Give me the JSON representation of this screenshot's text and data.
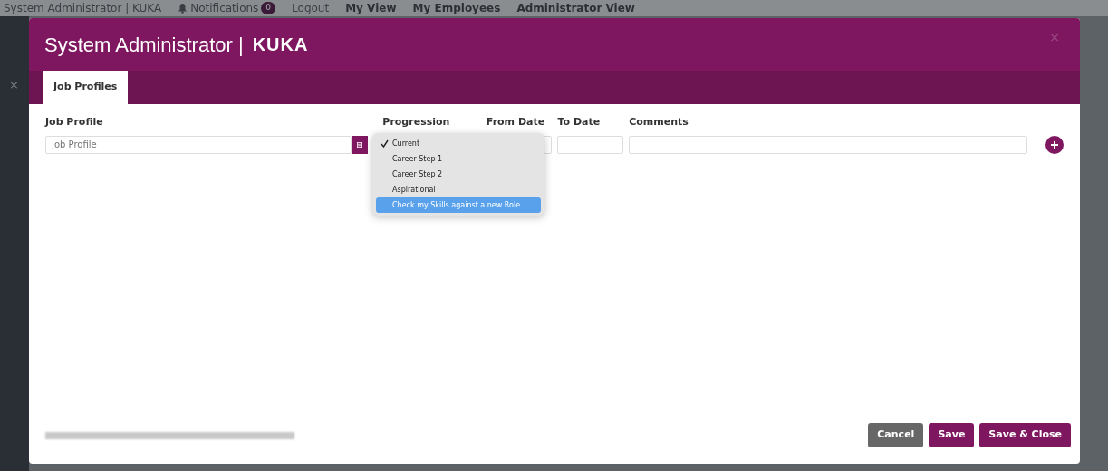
{
  "background_bar": {
    "title": "System Administrator | KUKA",
    "notifications": {
      "label": "Notifications",
      "count": "0"
    },
    "logout": "Logout",
    "close": "×",
    "nav": [
      {
        "label": "My View"
      },
      {
        "label": "My Employees"
      },
      {
        "label": "Administrator View"
      }
    ]
  },
  "modal": {
    "title": "System Administrator |",
    "logo": "KUKA",
    "close": "×",
    "tabs": [
      {
        "label": "Job Profiles",
        "selected": true
      }
    ],
    "fields": [
      {
        "kind": "lookup",
        "label": "Job Profile",
        "placeholder": "Job Profile"
      },
      {
        "kind": "select",
        "label": "Progression"
      },
      {
        "kind": "input",
        "label": "From Date"
      },
      {
        "kind": "input",
        "label": "To Date"
      },
      {
        "kind": "input",
        "label": "Comments"
      }
    ],
    "dropdown": [
      {
        "label": "Current",
        "checked": true,
        "selected": false
      },
      {
        "label": "Career Step 1",
        "checked": false,
        "selected": false
      },
      {
        "label": "Career Step 2",
        "checked": false,
        "selected": false
      },
      {
        "label": "Aspirational",
        "checked": false,
        "selected": false
      },
      {
        "label": "Check my Skills against a new Role",
        "checked": false,
        "selected": true
      }
    ],
    "buttons": [
      {
        "kind": "secondary",
        "label": "Cancel"
      },
      {
        "kind": "primary",
        "label": "Save"
      },
      {
        "kind": "primary",
        "label": "Save & Close"
      }
    ]
  }
}
